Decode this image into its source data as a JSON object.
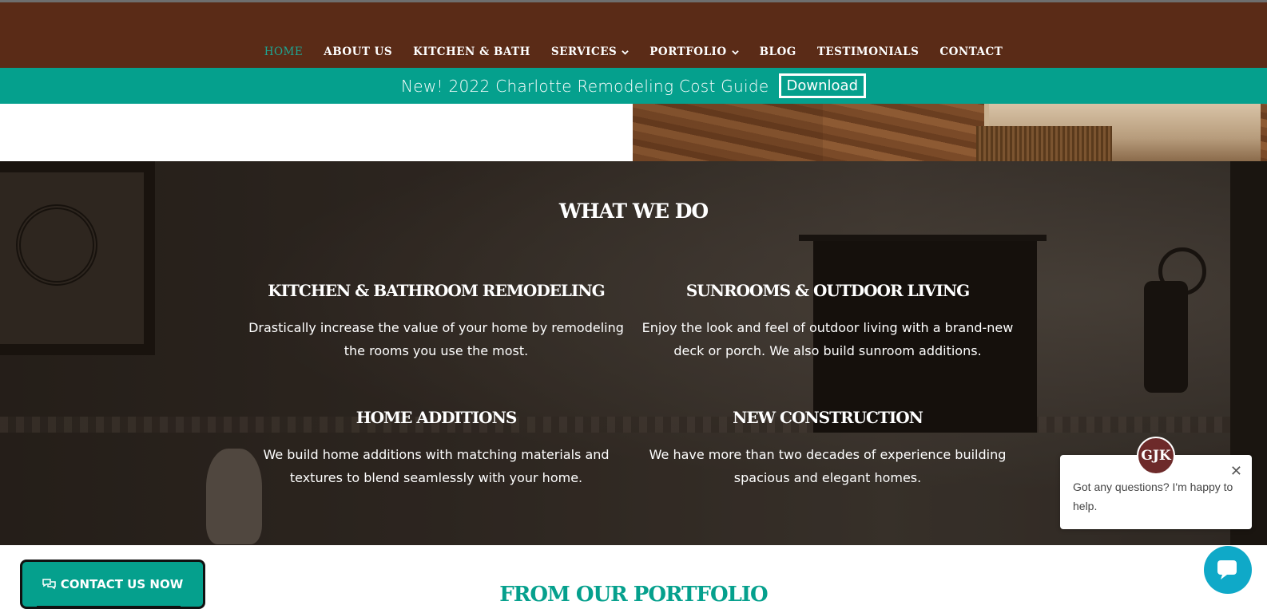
{
  "nav": {
    "items": [
      {
        "label": "HOME",
        "active": true,
        "dropdown": false
      },
      {
        "label": "ABOUT US",
        "active": false,
        "dropdown": false
      },
      {
        "label": "KITCHEN & BATH",
        "active": false,
        "dropdown": false
      },
      {
        "label": "SERVICES",
        "active": false,
        "dropdown": true
      },
      {
        "label": "PORTFOLIO",
        "active": false,
        "dropdown": true
      },
      {
        "label": "BLOG",
        "active": false,
        "dropdown": false
      },
      {
        "label": "TESTIMONIALS",
        "active": false,
        "dropdown": false
      },
      {
        "label": "CONTACT",
        "active": false,
        "dropdown": false
      }
    ]
  },
  "promo": {
    "text": "New! 2022 Charlotte Remodeling Cost Guide",
    "button_label": "Download"
  },
  "what_we_do": {
    "title": "WHAT WE DO",
    "services": [
      {
        "title": "KITCHEN & BATHROOM REMODELING",
        "text": "Drastically increase the value of your home by remodeling the rooms you use the most."
      },
      {
        "title": "SUNROOMS & OUTDOOR LIVING",
        "text": "Enjoy the look and feel of outdoor living with a brand-new deck or porch. We also build sunroom additions."
      },
      {
        "title": "HOME ADDITIONS",
        "text": "We build home additions with matching materials and textures to blend seamlessly with your home."
      },
      {
        "title": "NEW CONSTRUCTION",
        "text": "We have more than two decades of experience building spacious and elegant homes."
      }
    ]
  },
  "portfolio": {
    "title": "FROM OUR PORTFOLIO"
  },
  "contact_button": {
    "label": "CONTACT US NOW",
    "icon": "chat-bubbles-icon"
  },
  "chat": {
    "avatar_text": "GJK",
    "message": "Got any questions? I'm happy to help.",
    "close_glyph": "✕"
  },
  "colors": {
    "header_brown": "#5a2b17",
    "accent_teal": "#05a08d",
    "chat_blue": "#0fa9c8"
  }
}
